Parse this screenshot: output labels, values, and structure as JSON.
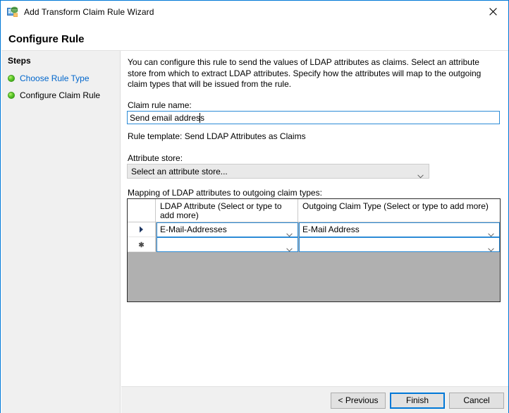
{
  "window": {
    "title": "Add Transform Claim Rule Wizard",
    "icon": "adfs-claim-rule-icon",
    "close_label": "✕"
  },
  "header": {
    "page_title": "Configure Rule"
  },
  "sidebar": {
    "heading": "Steps",
    "items": [
      {
        "label": "Choose Rule Type",
        "state": "link"
      },
      {
        "label": "Configure Claim Rule",
        "state": "current"
      }
    ]
  },
  "main": {
    "intro_text": "You can configure this rule to send the values of LDAP attributes as claims. Select an attribute store from which to extract LDAP attributes. Specify how the attributes will map to the outgoing claim types that will be issued from the rule.",
    "claim_rule_name_label": "Claim rule name:",
    "claim_rule_name_value": "Send email address",
    "claim_rule_name_placeholder": "",
    "rule_template_text": "Rule template: Send LDAP Attributes as Claims",
    "attribute_store_label": "Attribute store:",
    "attribute_store_value": "Select an attribute store...",
    "mapping_label": "Mapping of LDAP attributes to outgoing claim types:"
  },
  "grid": {
    "columns": [
      {
        "header": ""
      },
      {
        "header": "LDAP Attribute (Select or type to add more)"
      },
      {
        "header": "Outgoing Claim Type (Select or type to add more)"
      }
    ],
    "rows": [
      {
        "marker": "current-row-arrow",
        "ldap_attribute": "E-Mail-Addresses",
        "outgoing_claim_type": "E-Mail Address"
      },
      {
        "marker": "new-row-asterisk",
        "ldap_attribute": "",
        "outgoing_claim_type": ""
      }
    ]
  },
  "footer": {
    "previous_label": "< Previous",
    "finish_label": "Finish",
    "cancel_label": "Cancel"
  },
  "colors": {
    "accent": "#0078d7",
    "focus_border": "#2c8bd6",
    "link": "#0066cc",
    "sidebar_bg": "#f0f0f0",
    "grid_filler": "#b0b0b0",
    "step_bullet": "#5ec82c"
  }
}
